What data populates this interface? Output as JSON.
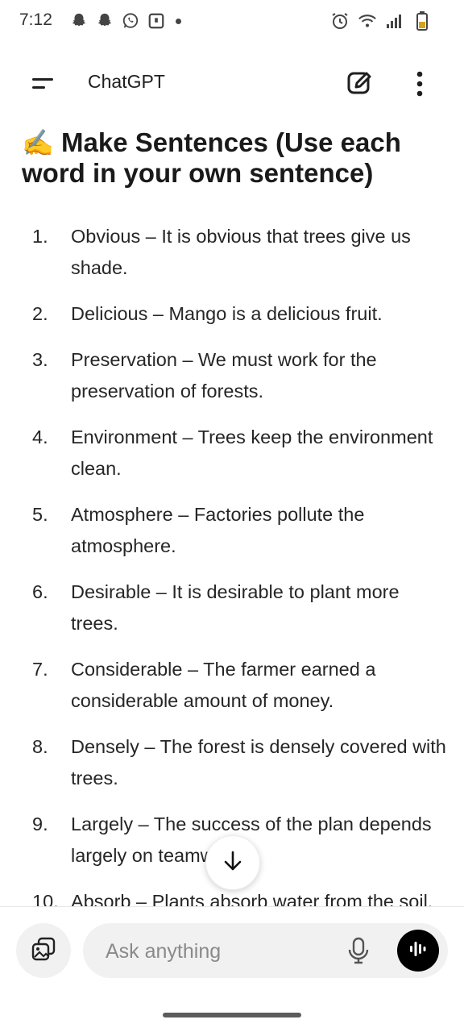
{
  "status_bar": {
    "time": "7:12",
    "left_icons": [
      "snapchat-icon",
      "snapchat-icon",
      "whatsapp-icon",
      "notification-box-icon"
    ],
    "right_icons": [
      "alarm-icon",
      "wifi-icon",
      "signal-icon",
      "battery-icon"
    ]
  },
  "app_bar": {
    "title": "ChatGPT",
    "menu_icon": "menu-icon",
    "new_chat_icon": "edit-icon",
    "more_icon": "more-vertical-icon"
  },
  "message": {
    "emoji": "✍️",
    "heading": "Make Sentences (Use each word in your own sentence)",
    "items": [
      {
        "num": "1.",
        "text": "Obvious – It is obvious that trees give us shade."
      },
      {
        "num": "2.",
        "text": "Delicious – Mango is a delicious fruit."
      },
      {
        "num": "3.",
        "text": "Preservation – We must work for the preservation of forests."
      },
      {
        "num": "4.",
        "text": "Environment – Trees keep the environment clean."
      },
      {
        "num": "5.",
        "text": "Atmosphere – Factories pollute the atmosphere."
      },
      {
        "num": "6.",
        "text": "Desirable – It is desirable to plant more trees."
      },
      {
        "num": "7.",
        "text": "Considerable – The farmer earned a considerable amount of money."
      },
      {
        "num": "8.",
        "text": "Densely – The forest is densely covered with trees."
      },
      {
        "num": "9.",
        "text": "Largely – The success of the plan depends largely on teamwork."
      },
      {
        "num": "10.",
        "text": "Absorb – Plants absorb water from the soil."
      }
    ]
  },
  "scroll_button": {
    "icon": "arrow-down-icon"
  },
  "composer": {
    "placeholder": "Ask anything",
    "attach_icon": "image-attach-icon",
    "mic_icon": "microphone-icon",
    "voice_icon": "voice-mode-icon"
  }
}
